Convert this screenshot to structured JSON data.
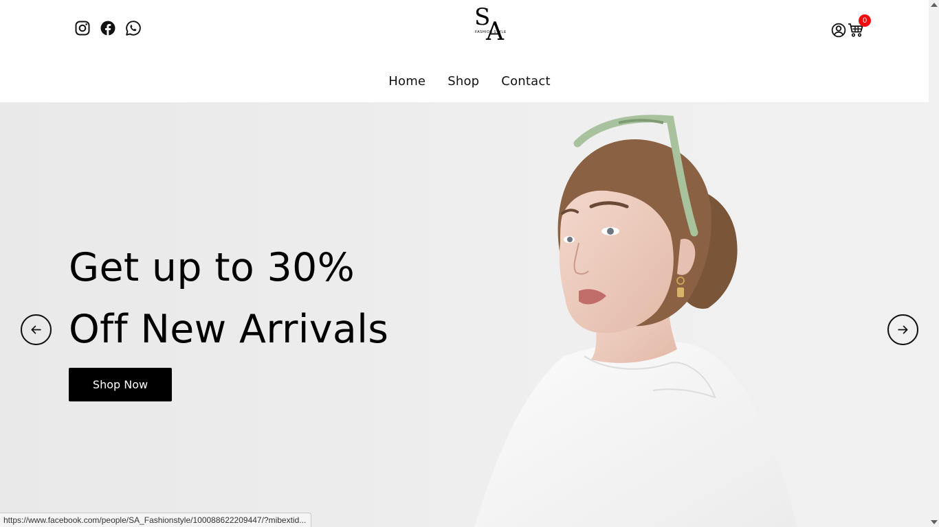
{
  "header": {
    "social": [
      {
        "name": "instagram-icon"
      },
      {
        "name": "facebook-icon"
      },
      {
        "name": "whatsapp-icon"
      }
    ],
    "logo": {
      "letters_top": "S",
      "letters_bottom": "A",
      "tagline": "FASHION STYLE"
    },
    "cart_count": "0"
  },
  "nav": {
    "items": [
      "Home",
      "Shop",
      "Contact"
    ]
  },
  "hero": {
    "headline_line1": "Get up to 30%",
    "headline_line2": "Off New Arrivals",
    "cta_label": "Shop Now"
  },
  "status_bar": {
    "url": "https://www.facebook.com/people/SA_Fashionstyle/100088622209447/?mibextid..."
  },
  "colors": {
    "badge": "#f20d0d",
    "cta_background": "#000000",
    "hero_background": "#ececec"
  }
}
